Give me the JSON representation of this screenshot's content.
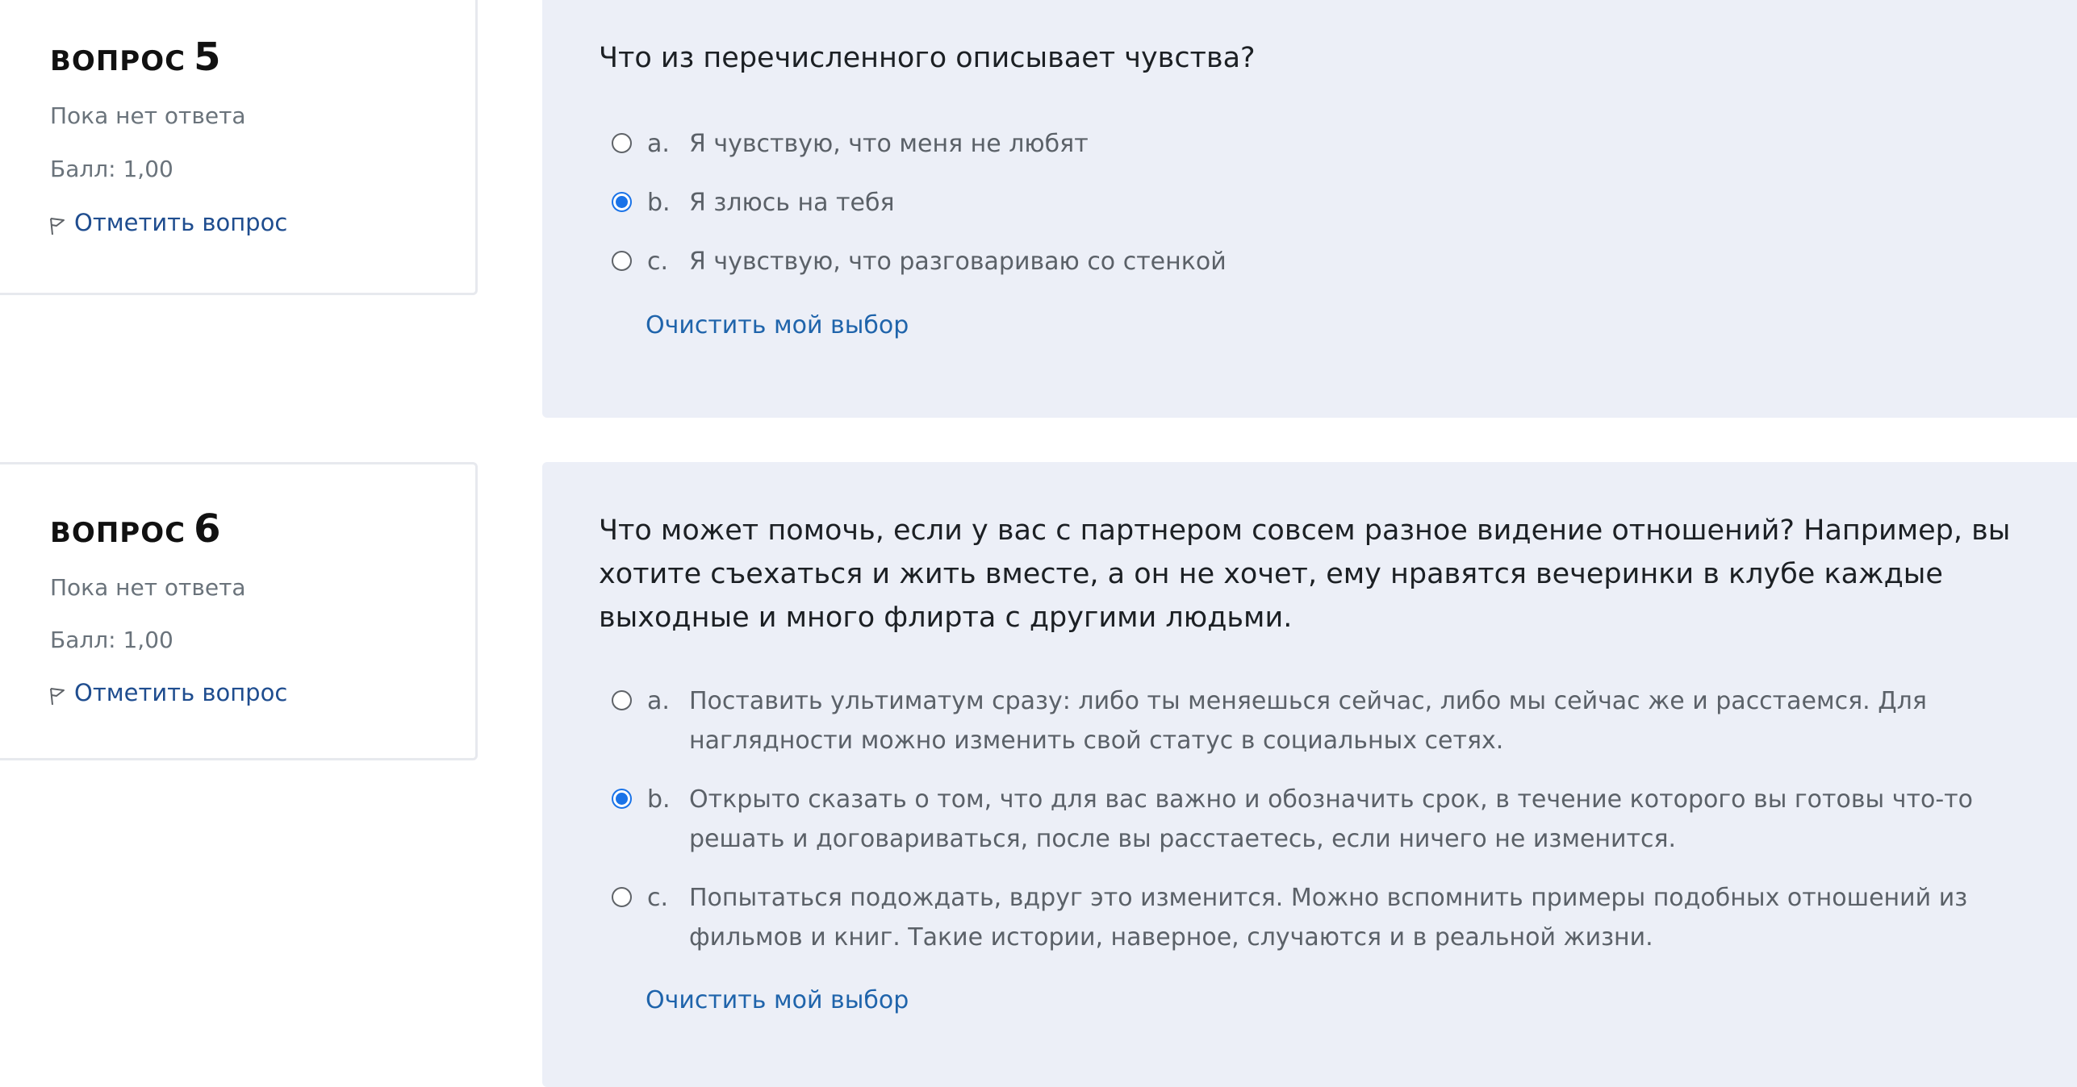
{
  "questions": [
    {
      "heading_word": "ВОПРОС",
      "number": "5",
      "state": "Пока нет ответа",
      "grade": "Балл: 1,00",
      "flag_label": "Отметить вопрос",
      "flag_icon": "flag-icon",
      "text": "Что из перечисленного описывает чувства?",
      "answers": [
        {
          "letter": "a.",
          "text": "Я чувствую, что меня не любят",
          "selected": false
        },
        {
          "letter": "b.",
          "text": "Я злюсь на тебя",
          "selected": true
        },
        {
          "letter": "c.",
          "text": "Я чувствую, что разговариваю со стенкой",
          "selected": false
        }
      ],
      "clear_label": "Очистить мой выбор"
    },
    {
      "heading_word": "ВОПРОС",
      "number": "6",
      "state": "Пока нет ответа",
      "grade": "Балл: 1,00",
      "flag_label": "Отметить вопрос",
      "flag_icon": "flag-icon",
      "text": "Что может помочь, если у вас с партнером совсем разное видение отношений? Например, вы хотите съехаться и жить вместе, а он не хочет, ему нравятся вечеринки в клубе каждые выходные и много флирта с другими людьми.",
      "answers": [
        {
          "letter": "a.",
          "text": "Поставить ультиматум сразу: либо ты меняешься сейчас, либо мы сейчас же и расстаемся. Для наглядности можно изменить свой статус в социальных сетях.",
          "selected": false
        },
        {
          "letter": "b.",
          "text": "Открыто сказать о том, что для вас важно и обозначить срок, в течение которого вы готовы что-то решать и договариваться, после вы расстаетесь, если ничего не изменится.",
          "selected": true
        },
        {
          "letter": "c.",
          "text": "Попытаться подождать, вдруг это изменится. Можно вспомнить примеры подобных отношений из фильмов и книг. Такие истории, наверное, случаются и в реальной жизни.",
          "selected": false
        }
      ],
      "clear_label": "Очистить мой выбор"
    }
  ],
  "colors": {
    "accent": "#1a73e8",
    "link": "#1f64ab",
    "flag_link": "#1f4d8f",
    "content_bg": "#eceff7"
  }
}
